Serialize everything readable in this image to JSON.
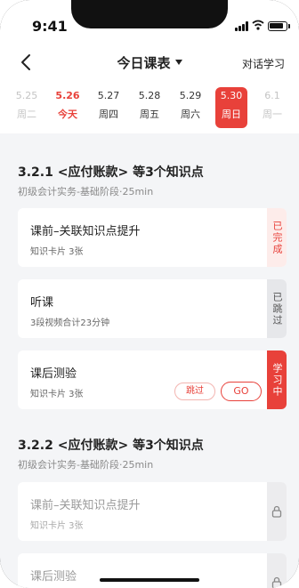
{
  "status": {
    "time": "9:41"
  },
  "header": {
    "title": "今日课表",
    "right_link": "对话学习"
  },
  "dates": [
    {
      "day": "5.25",
      "week": "周二",
      "state": "past"
    },
    {
      "day": "5.26",
      "week": "今天",
      "state": "today"
    },
    {
      "day": "5.27",
      "week": "周四",
      "state": "normal"
    },
    {
      "day": "5.28",
      "week": "周五",
      "state": "normal"
    },
    {
      "day": "5.29",
      "week": "周六",
      "state": "normal"
    },
    {
      "day": "5.30",
      "week": "周日",
      "state": "selected"
    },
    {
      "day": "6.1",
      "week": "周一",
      "state": "fade"
    }
  ],
  "sections": [
    {
      "title": "3.2.1 <应付账款> 等3个知识点",
      "subtitle": "初级会计实务-基础阶段·25min",
      "cards": [
        {
          "name": "课前–关联知识点提升",
          "meta": "知识卡片 3张",
          "status": "已完成"
        },
        {
          "name": "听课",
          "meta": "3段视频合计23分钟",
          "status": "已跳过"
        },
        {
          "name": "课后测验",
          "meta": "知识卡片 3张",
          "status": "学习中",
          "skip_label": "跳过",
          "go_label": "GO"
        }
      ]
    },
    {
      "title": "3.2.2 <应付账款> 等3个知识点",
      "subtitle": "初级会计实务-基础阶段·25min",
      "cards": [
        {
          "name": "课前–关联知识点提升",
          "meta": "知识卡片 3张",
          "icon": "lock-icon"
        },
        {
          "name": "课后测验",
          "meta": "",
          "icon": "lock-icon"
        }
      ]
    }
  ],
  "colors": {
    "accent": "#e8413a",
    "background": "#f4f5f7"
  }
}
